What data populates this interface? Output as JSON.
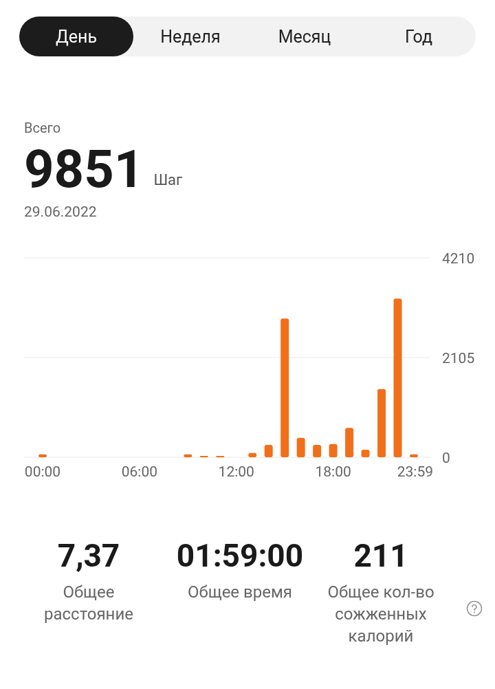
{
  "tabs": [
    {
      "label": "День",
      "selected": true
    },
    {
      "label": "Неделя",
      "selected": false
    },
    {
      "label": "Месяц",
      "selected": false
    },
    {
      "label": "Год",
      "selected": false
    }
  ],
  "summary": {
    "label": "Всего",
    "value": "9851",
    "unit": "Шаг",
    "date": "29.06.2022"
  },
  "chart": {
    "chart_data": {
      "type": "bar",
      "x": [
        0,
        1,
        2,
        3,
        4,
        5,
        6,
        7,
        8,
        9,
        10,
        11,
        12,
        13,
        14,
        15,
        16,
        17,
        18,
        19,
        20,
        21,
        22,
        23
      ],
      "series": [
        {
          "color": "#f26f1a",
          "values": [
            60,
            0,
            0,
            0,
            0,
            0,
            0,
            0,
            0,
            60,
            30,
            30,
            0,
            90,
            260,
            2930,
            410,
            260,
            280,
            620,
            160,
            1440,
            3350,
            60
          ]
        }
      ],
      "xlim": [
        -1.15,
        23.98
      ],
      "ylim": [
        0,
        4210
      ],
      "yticks": [
        0,
        2105,
        4210
      ],
      "xticks": [
        {
          "value": 0,
          "label": "00:00"
        },
        {
          "value": 6,
          "label": "06:00"
        },
        {
          "value": 12,
          "label": "12:00"
        },
        {
          "value": 18,
          "label": "18:00"
        },
        {
          "value": 23.98,
          "label": "23:59"
        }
      ]
    }
  },
  "stats": [
    {
      "value": "7,37",
      "label": "Общее расстояние",
      "help": false
    },
    {
      "value": "01:59:00",
      "label": "Общее время",
      "help": false
    },
    {
      "value": "211",
      "label": "Общее кол-во сожженных калорий",
      "help": true
    }
  ]
}
